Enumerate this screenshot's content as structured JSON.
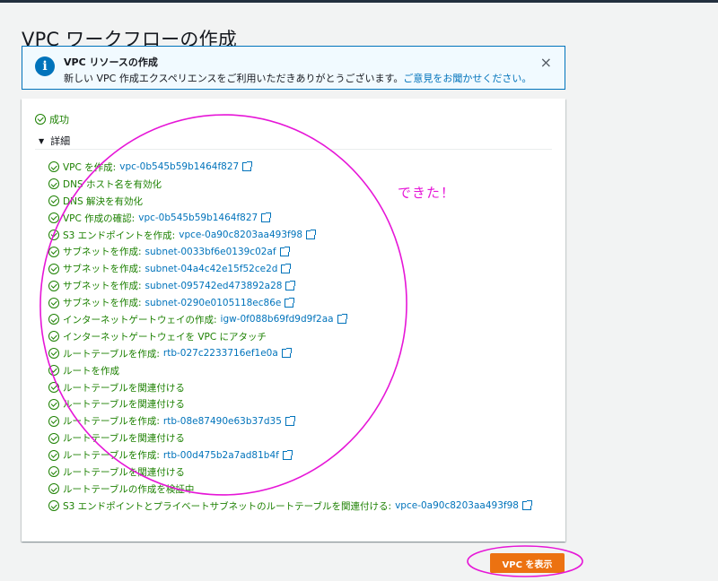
{
  "page": {
    "title": "VPC ワークフローの作成"
  },
  "flash": {
    "title": "VPC リソースの作成",
    "body": "新しい VPC 作成エクスペリエンスをご利用いただきありがとうございます。",
    "link": "ご意見をお聞かせください。",
    "info_icon": "i",
    "close_icon": "×"
  },
  "status": {
    "label": "成功"
  },
  "details": {
    "label": "詳細",
    "caret": "▼"
  },
  "steps": [
    {
      "text": "VPC を作成:",
      "link": "vpc-0b545b59b1464f827"
    },
    {
      "text": "DNS ホスト名を有効化"
    },
    {
      "text": "DNS 解決を有効化"
    },
    {
      "text": "VPC 作成の確認:",
      "link": "vpc-0b545b59b1464f827"
    },
    {
      "text": "S3 エンドポイントを作成:",
      "link": "vpce-0a90c8203aa493f98"
    },
    {
      "text": "サブネットを作成:",
      "link": "subnet-0033bf6e0139c02af"
    },
    {
      "text": "サブネットを作成:",
      "link": "subnet-04a4c42e15f52ce2d"
    },
    {
      "text": "サブネットを作成:",
      "link": "subnet-095742ed473892a28"
    },
    {
      "text": "サブネットを作成:",
      "link": "subnet-0290e0105118ec86e"
    },
    {
      "text": "インターネットゲートウェイの作成:",
      "link": "igw-0f088b69fd9d9f2aa"
    },
    {
      "text": "インターネットゲートウェイを VPC にアタッチ"
    },
    {
      "text": "ルートテーブルを作成:",
      "link": "rtb-027c2233716ef1e0a"
    },
    {
      "text": "ルートを作成"
    },
    {
      "text": "ルートテーブルを関連付ける"
    },
    {
      "text": "ルートテーブルを関連付ける"
    },
    {
      "text": "ルートテーブルを作成:",
      "link": "rtb-08e87490e63b37d35"
    },
    {
      "text": "ルートテーブルを関連付ける"
    },
    {
      "text": "ルートテーブルを作成:",
      "link": "rtb-00d475b2a7ad81b4f"
    },
    {
      "text": "ルートテーブルを関連付ける"
    },
    {
      "text": "ルートテーブルの作成を検証中"
    },
    {
      "text": "S3 エンドポイントとプライベートサブネットのルートテーブルを関連付ける:",
      "link": "vpce-0a90c8203aa493f98"
    }
  ],
  "actions": {
    "view_vpc": "VPC を表示"
  },
  "annotation": {
    "text": "できた！",
    "color": "#e616d7"
  },
  "colors": {
    "success": "#1d8102",
    "link": "#0073bb",
    "primary": "#ec7211",
    "info": "#0073bb"
  }
}
